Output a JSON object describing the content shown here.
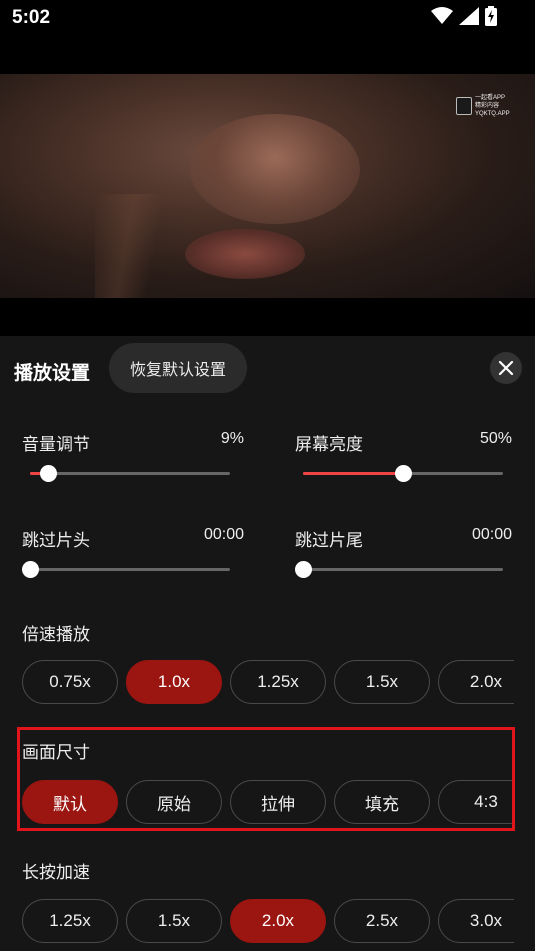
{
  "status_bar": {
    "time": "5:02"
  },
  "video": {
    "watermark": {
      "line1": "一起看APP",
      "line2": "精彩内容 YQKTQ.APP"
    }
  },
  "panel": {
    "title": "播放设置",
    "reset_label": "恢复默认设置",
    "close_icon": "close-icon"
  },
  "sliders": {
    "volume": {
      "label": "音量调节",
      "value_text": "9%",
      "level": 0.09
    },
    "brightness": {
      "label": "屏幕亮度",
      "value_text": "50%",
      "level": 0.5
    },
    "skip_intro": {
      "label": "跳过片头",
      "value_text": "00:00",
      "level": 0
    },
    "skip_outro": {
      "label": "跳过片尾",
      "value_text": "00:00",
      "level": 0
    }
  },
  "speed": {
    "label": "倍速播放",
    "options": [
      "0.75x",
      "1.0x",
      "1.25x",
      "1.5x",
      "2.0x"
    ],
    "selected": "1.0x"
  },
  "aspect": {
    "label": "画面尺寸",
    "options": [
      "默认",
      "原始",
      "拉伸",
      "填充",
      "4:3"
    ],
    "selected": "默认"
  },
  "long_press": {
    "label": "长按加速",
    "options": [
      "1.25x",
      "1.5x",
      "2.0x",
      "2.5x",
      "3.0x"
    ],
    "selected": "2.0x"
  },
  "colors": {
    "accent": "#9b1511",
    "highlight": "#e0141b",
    "slider_fill": "#e44"
  }
}
